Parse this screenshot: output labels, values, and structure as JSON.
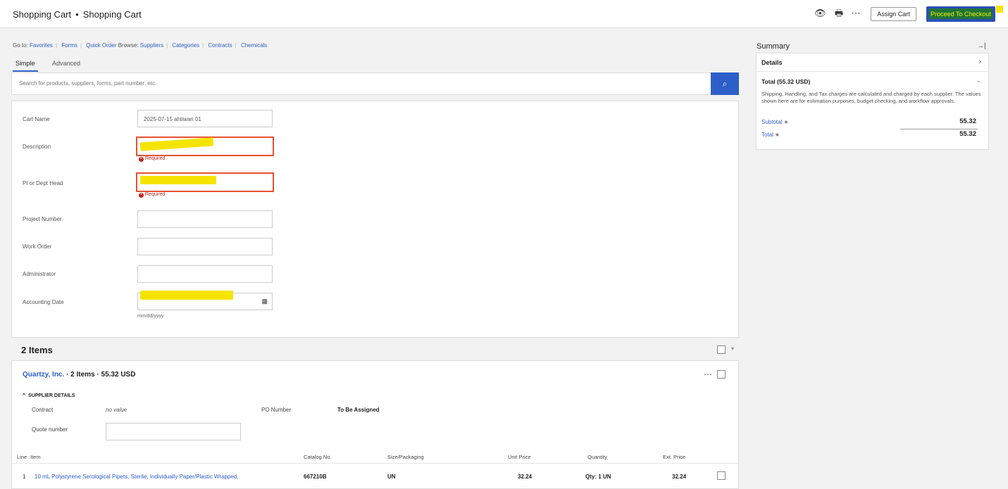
{
  "header": {
    "breadcrumb": [
      "Shopping Cart",
      "Shopping Cart"
    ],
    "separator": "•",
    "assign_cart": "Assign Cart",
    "checkout": "Proceed To Checkout"
  },
  "goto": {
    "label": "Go to:",
    "links": [
      "Favorites",
      "Forms",
      "Quick Order"
    ],
    "browse_label": "Browse:",
    "browse_links": [
      "Suppliers",
      "Categories",
      "Contracts",
      "Chemicals"
    ]
  },
  "tabs": [
    "Simple",
    "Advanced"
  ],
  "search": {
    "placeholder": "Search for products, suppliers, forms, part number, etc."
  },
  "form": {
    "cart_name_label": "Cart Name",
    "cart_name_value": "2025-07-15 ahtiwari 01",
    "description_label": "Description",
    "pi_label": "PI or Dept Head",
    "required": "Required",
    "project_label": "Project Number",
    "work_order_label": "Work Order",
    "admin_label": "Administrator",
    "accounting_label": "Accounting Date",
    "date_hint": "mm/dd/yyyy"
  },
  "items": {
    "title": "2 Items",
    "supplier": "Quartzy, Inc.",
    "supplier_meta": "· 2 Items · 55.32 USD",
    "supplier_details": "SUPPLIER DETAILS",
    "contract_label": "Contract",
    "contract_value": "no value",
    "po_label": "PO Number",
    "po_value": "To Be Assigned",
    "quote_label": "Quote number",
    "columns": {
      "line": "Line",
      "item": "Item",
      "catalog": "Catalog No.",
      "size": "Size/Packaging",
      "unit_price": "Unit Price",
      "quantity": "Quantity",
      "ext_price": "Ext. Price"
    },
    "rows": [
      {
        "line": "1",
        "item": "10 mL Polystyrene Serological Pipets, Sterile, Individually Paper/Plastic Wrapped,",
        "catalog": "667210B",
        "size": "UN",
        "unit_price": "32.24",
        "quantity": "Qty: 1 UN",
        "ext_price": "32.24"
      }
    ]
  },
  "summary": {
    "title": "Summary",
    "details": "Details",
    "total_heading": "Total (55.32 USD)",
    "note": "Shipping, Handling, and Tax charges are calculated and charged by each supplier. The values shown here are for estimation purposes, budget checking, and workflow approvals.",
    "subtotal_label": "Subtotal",
    "subtotal_value": "55.32",
    "total_label": "Total",
    "total_value": "55.32"
  }
}
